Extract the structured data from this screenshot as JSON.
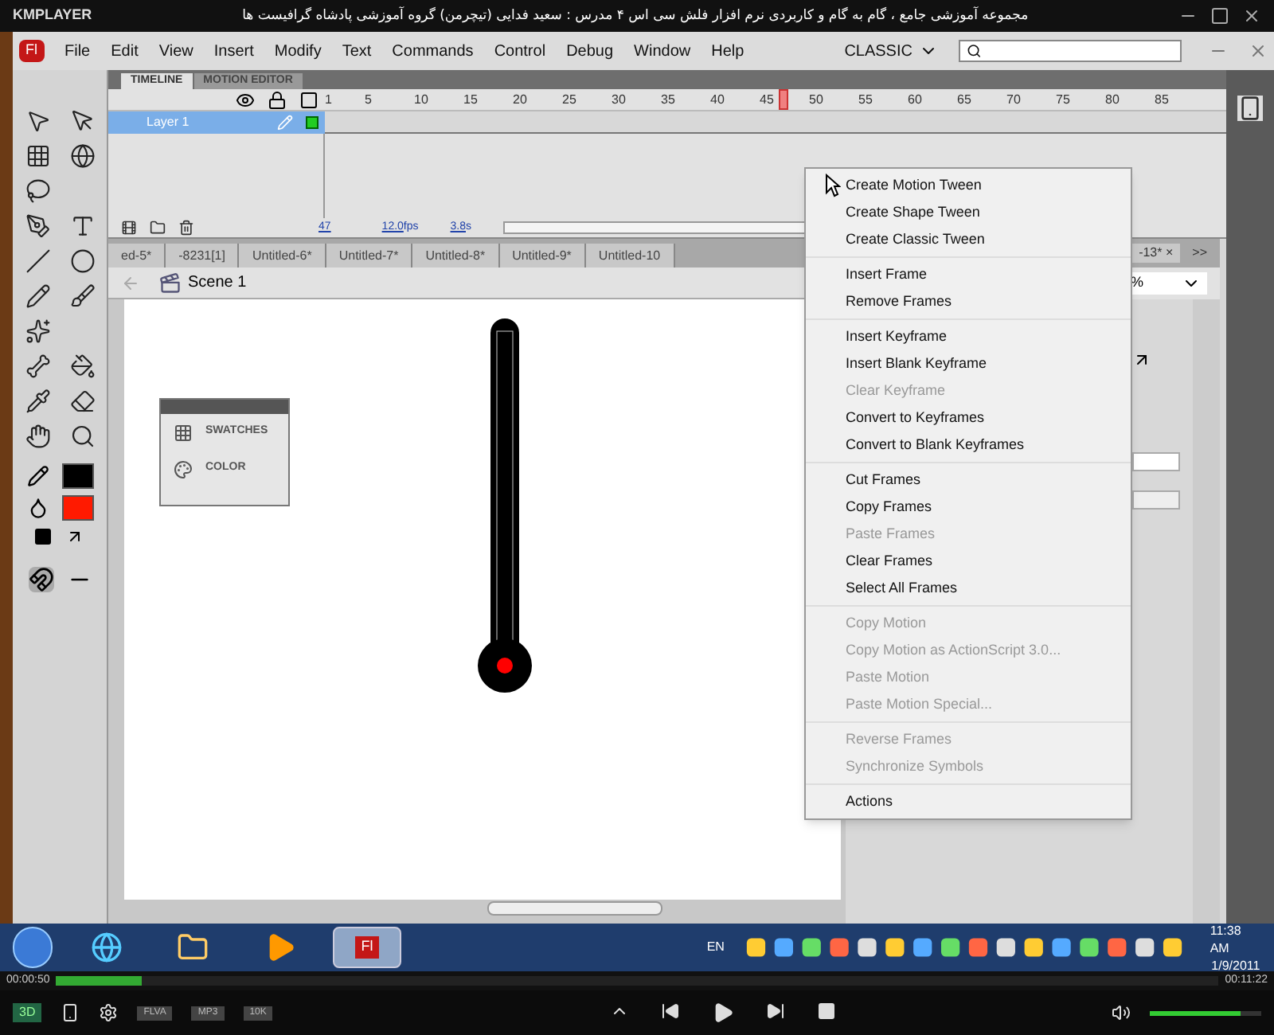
{
  "player": {
    "logo": "KMPLAYER",
    "title": "مجموعه آموزشی جامع ، گام به گام و کاربردی نرم افزار فلش سی اس ۴ مدرس : سعید فدایی (تیچرمن) گروه آموزشی پادشاه گرافیست ها"
  },
  "app": {
    "logo": "Fl",
    "menus": [
      "File",
      "Edit",
      "View",
      "Insert",
      "Modify",
      "Text",
      "Commands",
      "Control",
      "Debug",
      "Window",
      "Help"
    ],
    "workspace": "CLASSIC"
  },
  "timeline": {
    "tabs": [
      {
        "label": "TIMELINE",
        "selected": true
      },
      {
        "label": "MOTION EDITOR",
        "selected": false
      }
    ],
    "ruler": [
      "1",
      "5",
      "10",
      "15",
      "20",
      "25",
      "30",
      "35",
      "40",
      "45",
      "50",
      "55",
      "60",
      "65",
      "70",
      "75",
      "80",
      "85"
    ],
    "layers": [
      {
        "name": "Layer 1",
        "selected": true
      }
    ],
    "current_frame": "47",
    "fps": "12.0",
    "fps_unit": "fps",
    "elapsed": "3.8",
    "elapsed_unit": "s"
  },
  "documents": [
    {
      "label": "ed-5*",
      "selected": false
    },
    {
      "label": "-8231[1]",
      "selected": false
    },
    {
      "label": "Untitled-6*",
      "selected": false
    },
    {
      "label": "Untitled-7*",
      "selected": false
    },
    {
      "label": "Untitled-8*",
      "selected": false
    },
    {
      "label": "Untitled-9*",
      "selected": false
    },
    {
      "label": "Untitled-10",
      "selected": false
    }
  ],
  "documents_right": {
    "label": "-13*",
    "close": "×",
    "more": ">>"
  },
  "scene": {
    "label": "Scene 1",
    "zoom": "%"
  },
  "color_swatches": [
    {
      "color": "#000000"
    },
    {
      "color": "#ff1a00"
    }
  ],
  "floating_panel": {
    "items": [
      "SWATCHES",
      "COLOR"
    ]
  },
  "context_menu": [
    [
      {
        "label": "Create Motion Tween",
        "disabled": false
      },
      {
        "label": "Create Shape Tween",
        "disabled": false
      },
      {
        "label": "Create Classic Tween",
        "disabled": false
      }
    ],
    [
      {
        "label": "Insert Frame",
        "disabled": false
      },
      {
        "label": "Remove Frames",
        "disabled": false
      }
    ],
    [
      {
        "label": "Insert Keyframe",
        "disabled": false
      },
      {
        "label": "Insert Blank Keyframe",
        "disabled": false
      },
      {
        "label": "Clear Keyframe",
        "disabled": true
      },
      {
        "label": "Convert to Keyframes",
        "disabled": false
      },
      {
        "label": "Convert to Blank Keyframes",
        "disabled": false
      }
    ],
    [
      {
        "label": "Cut Frames",
        "disabled": false
      },
      {
        "label": "Copy Frames",
        "disabled": false
      },
      {
        "label": "Paste Frames",
        "disabled": true
      },
      {
        "label": "Clear Frames",
        "disabled": false
      },
      {
        "label": "Select All Frames",
        "disabled": false
      }
    ],
    [
      {
        "label": "Copy Motion",
        "disabled": true
      },
      {
        "label": "Copy Motion as ActionScript 3.0...",
        "disabled": true
      },
      {
        "label": "Paste Motion",
        "disabled": true
      },
      {
        "label": "Paste Motion Special...",
        "disabled": true
      }
    ],
    [
      {
        "label": "Reverse Frames",
        "disabled": true
      },
      {
        "label": "Synchronize Symbols",
        "disabled": true
      }
    ],
    [
      {
        "label": "Actions",
        "disabled": false
      }
    ]
  ],
  "taskbar": {
    "apps": [
      {
        "kind": "ie",
        "selected": false
      },
      {
        "kind": "explorer",
        "selected": false
      },
      {
        "kind": "media",
        "selected": false
      },
      {
        "kind": "flash",
        "selected": true,
        "label": "Fl"
      }
    ],
    "language": "EN",
    "time": "11:38 AM",
    "date": "1/9/2011"
  },
  "playback": {
    "position": "00:00:50",
    "duration": "00:11:22",
    "level": 0.073,
    "mode": "3D",
    "tags": [
      "FLVA",
      "MP3",
      "10K"
    ],
    "volume": {
      "level": 0.82
    }
  }
}
